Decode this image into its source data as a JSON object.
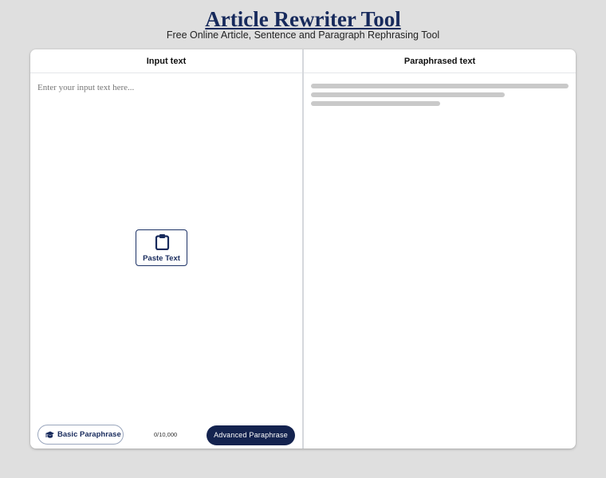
{
  "header": {
    "title": "Article Rewriter Tool",
    "subtitle": "Free Online Article, Sentence and Paragraph Rephrasing Tool"
  },
  "input_pane": {
    "header": "Input text",
    "placeholder": "Enter your input text here...",
    "value": "",
    "paste_button": {
      "label": "Paste Text",
      "icon": "clipboard-icon"
    },
    "basic_button": {
      "label": "Basic Paraphrase",
      "icon": "graduation-cap-icon"
    },
    "char_count": "0/10,000",
    "advanced_button": {
      "label": "Advanced Paraphrase"
    }
  },
  "output_pane": {
    "header": "Paraphrased text",
    "state": "loading-placeholder"
  },
  "colors": {
    "brand": "#172a5c",
    "primary_button": "#14234f",
    "background": "#dfdfdf",
    "skeleton": "#c9c9c9"
  }
}
